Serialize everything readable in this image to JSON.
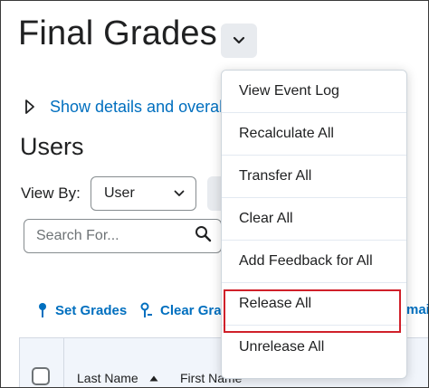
{
  "page": {
    "title": "Final Grades"
  },
  "details": {
    "link_text": "Show details and overall"
  },
  "users": {
    "section_title": "Users",
    "view_by_label": "View By:",
    "view_by_value": "User",
    "search_placeholder": "Search For..."
  },
  "actions": {
    "set_grades": "Set Grades",
    "clear_grades": "Clear Grade",
    "email_fragment": "mail"
  },
  "grid": {
    "columns": [
      "Last Name",
      "First Name"
    ]
  },
  "menu": {
    "items": [
      "View Event Log",
      "Recalculate All",
      "Transfer All",
      "Clear All",
      "Add Feedback for All",
      "Release All",
      "Unrelease All"
    ],
    "highlighted": "Release All"
  },
  "colors": {
    "link": "#006fbf",
    "highlight": "#d0202a"
  },
  "icons": {
    "title_menu": "chevron-down-icon",
    "details": "caret-right-icon",
    "select": "chevron-down-icon",
    "search": "search-icon",
    "set_grades": "pin-icon",
    "clear_grades": "pin-remove-icon",
    "sort": "sort-ascending-icon"
  }
}
